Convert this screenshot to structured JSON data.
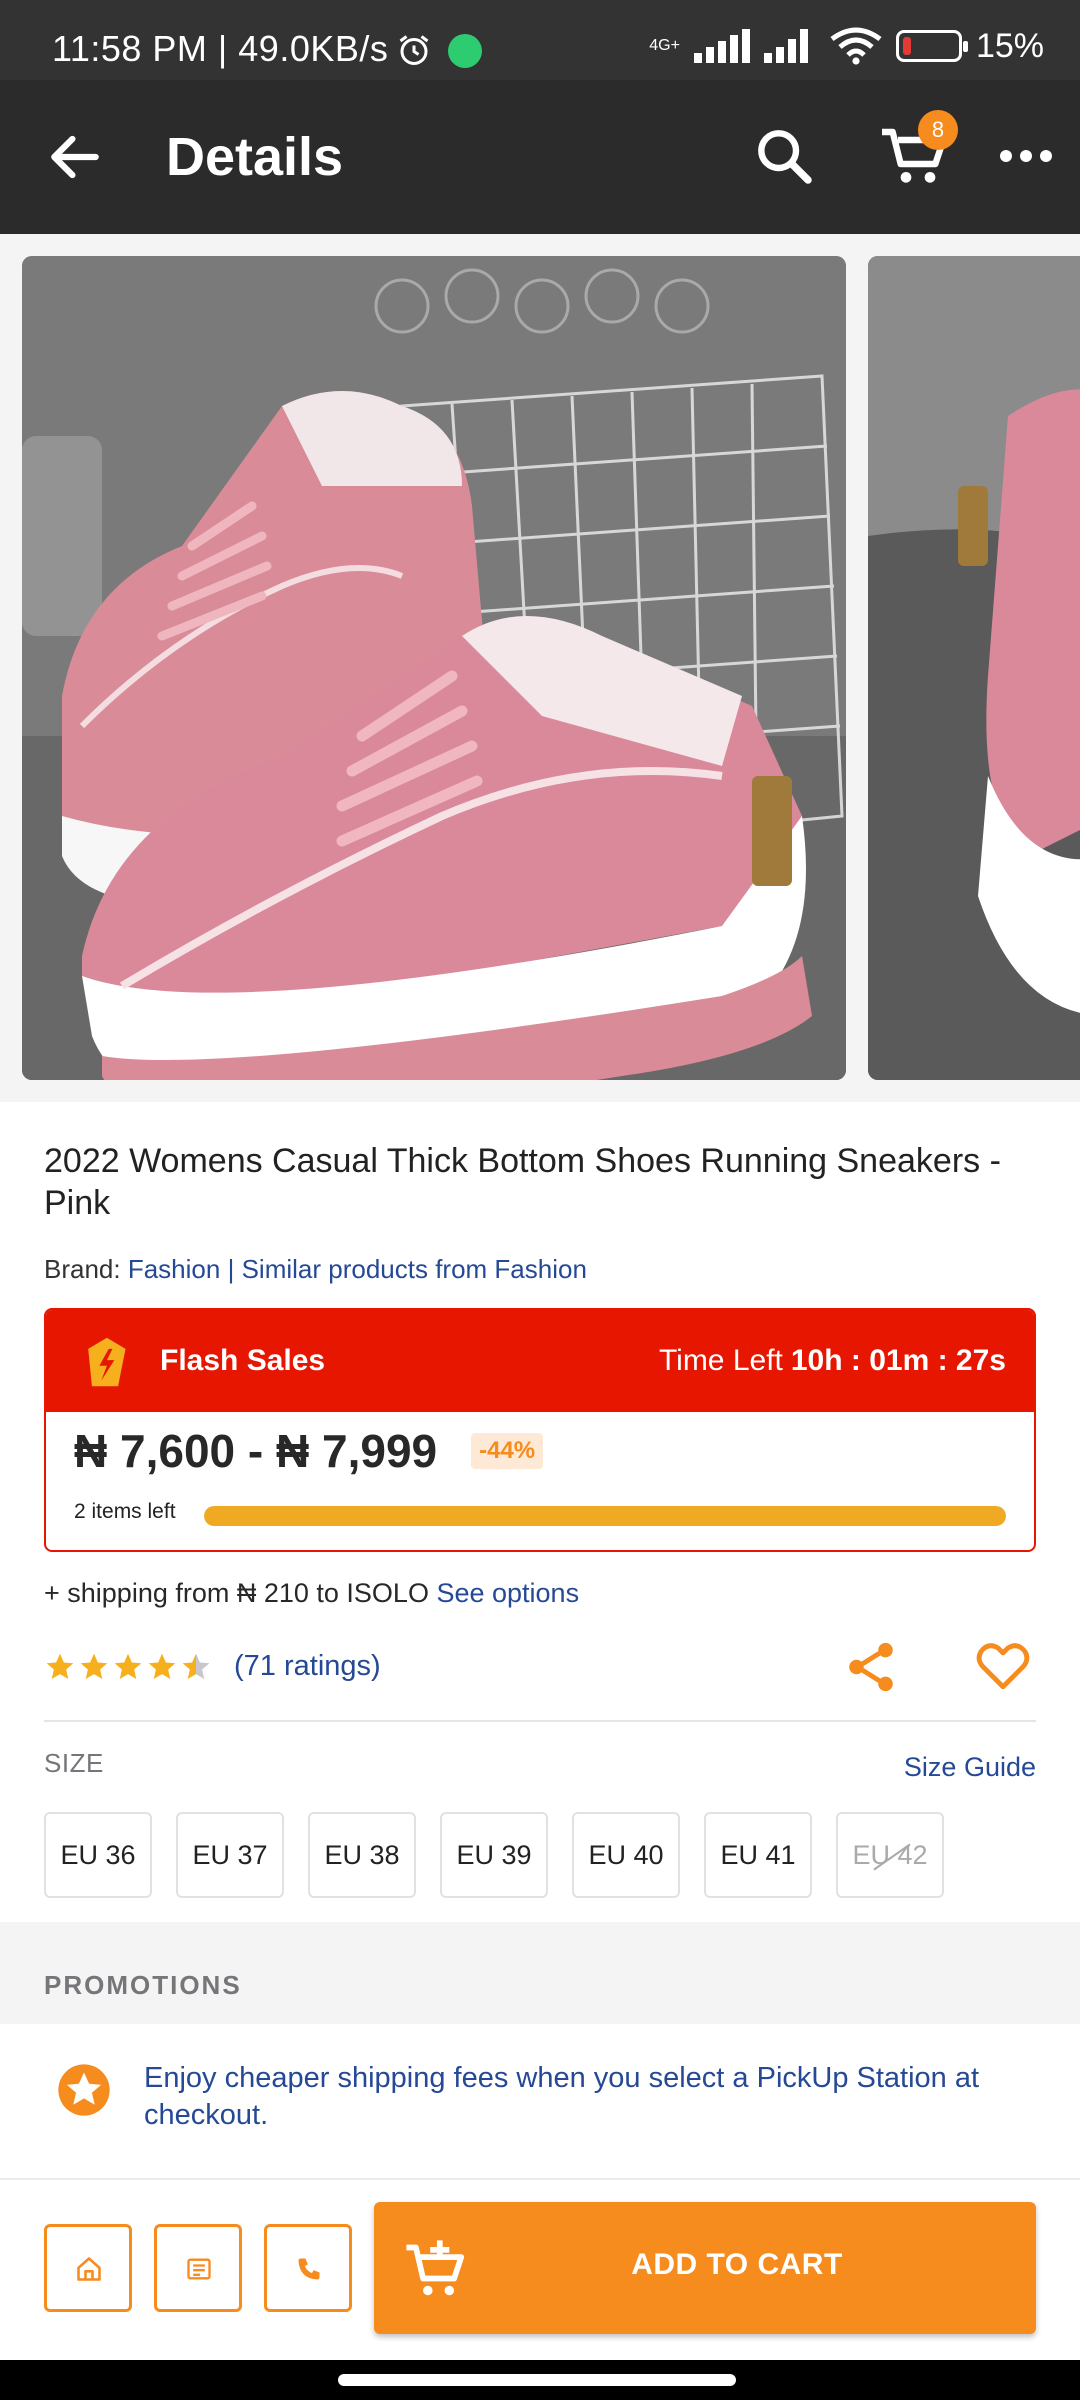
{
  "status_bar": {
    "time": "11:58 PM | 49.0KB/s",
    "network": "4G+",
    "battery": "15%",
    "battery_level": 0.15
  },
  "app_bar": {
    "title": "Details",
    "cart_count": "8",
    "icons": [
      "back-arrow-icon",
      "search-icon",
      "cart-icon",
      "more-options-icon"
    ]
  },
  "product": {
    "title": "2022 Womens Casual Thick Bottom Shoes Running Sneakers - Pink",
    "brand_prefix": "Brand:",
    "brand_name": "Fashion",
    "separator": "|",
    "similar_link": "Similar products from Fashion"
  },
  "flash_sale": {
    "label": "Flash Sales",
    "time_left_label": "Time Left",
    "time_left": "10h : 01m : 27s",
    "price": "₦ 7,600 - ₦ 7,999",
    "discount": "-44%",
    "items_left": "2 items left",
    "stock_progress": 1.0,
    "colors": {
      "header": "#e61601",
      "bar": "#f0a922"
    }
  },
  "shipping": {
    "text": "+ shipping from ₦ 210 to ISOLO",
    "link": "See options"
  },
  "rating": {
    "stars": 4.5,
    "count_text": "(71 ratings)"
  },
  "size": {
    "label": "SIZE",
    "guide": "Size Guide",
    "options": [
      "EU 36",
      "EU 37",
      "EU 38",
      "EU 39",
      "EU 40",
      "EU 41",
      "EU 42"
    ],
    "unavailable": "EU 42"
  },
  "promotions": {
    "header": "PROMOTIONS",
    "items": [
      "Enjoy cheaper shipping fees when you select a PickUp Station at checkout."
    ]
  },
  "bottom_bar": {
    "add_to_cart": "ADD TO CART",
    "icons": [
      "home-icon",
      "store-icon",
      "phone-icon"
    ]
  },
  "colors": {
    "accent": "#f68b1e",
    "link": "#264996",
    "app_bar": "#2b2b2b"
  }
}
